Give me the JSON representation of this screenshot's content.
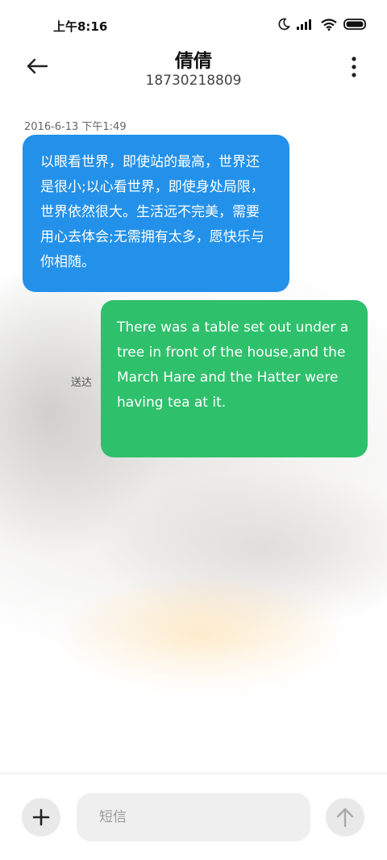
{
  "status_bar": {
    "time": "上午8:16",
    "icons": [
      "moon-icon",
      "signal-icon",
      "wifi-icon",
      "battery-icon"
    ]
  },
  "header": {
    "contact_name": "倩倩",
    "contact_number": "18730218809",
    "back_icon": "back-arrow-icon",
    "menu_icon": "more-vertical-icon"
  },
  "conversation": {
    "timestamp": "2016-6-13 下午1:49",
    "messages": [
      {
        "direction": "incoming",
        "text": "以眼看世界，即使站的最高，世界还是很小;以心看世界，即使身处局限，世界依然很大。生活远不完美，需要用心去体会;无需拥有太多，愿快乐与你相随。",
        "color": "#2391ea"
      },
      {
        "direction": "outgoing",
        "text": "There was a table set out under a tree in front of the house,and the March Hare and the Hatter were having tea at it.",
        "status": "送达",
        "color": "#2fc06c"
      }
    ]
  },
  "composer": {
    "placeholder": "短信",
    "value": "",
    "add_icon": "plus-icon",
    "send_icon": "arrow-up-icon"
  }
}
